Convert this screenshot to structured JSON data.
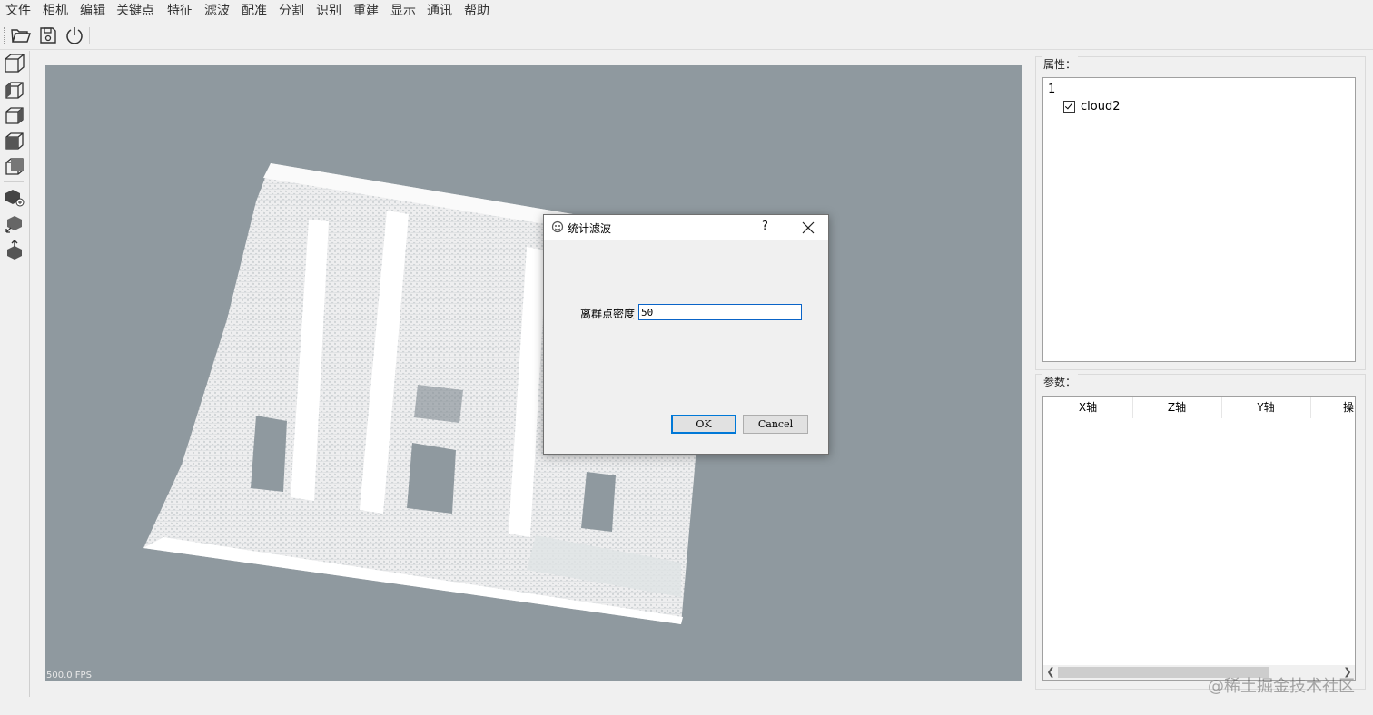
{
  "menubar": {
    "items": [
      "文件",
      "相机",
      "编辑",
      "关键点",
      "特征",
      "滤波",
      "配准",
      "分割",
      "识别",
      "重建",
      "显示",
      "通讯",
      "帮助"
    ]
  },
  "toolbar": {
    "buttons": [
      "open-folder-icon",
      "save-icon",
      "power-icon"
    ]
  },
  "left_tools": {
    "buttons": [
      "cube-front-view-icon",
      "cube-left-view-icon",
      "cube-right-view-icon",
      "cube-top-view-icon",
      "cube-back-view-icon",
      "cube-add-icon",
      "cube-move-icon",
      "cube-export-icon"
    ]
  },
  "viewport": {
    "fps": "500.0 FPS",
    "background_color": "#8f999f"
  },
  "properties": {
    "title": "属性：",
    "tree_root": "1",
    "tree_child": "cloud2",
    "tree_child_checked": true
  },
  "params": {
    "title": "参数：",
    "columns": [
      "X轴",
      "Z轴",
      "Y轴",
      "操"
    ]
  },
  "dialog": {
    "title": "统计滤波",
    "help": "?",
    "label": "离群点密度",
    "input_value": "50",
    "ok_label": "OK",
    "cancel_label": "Cancel"
  },
  "watermark": "@稀土掘金技术社区"
}
